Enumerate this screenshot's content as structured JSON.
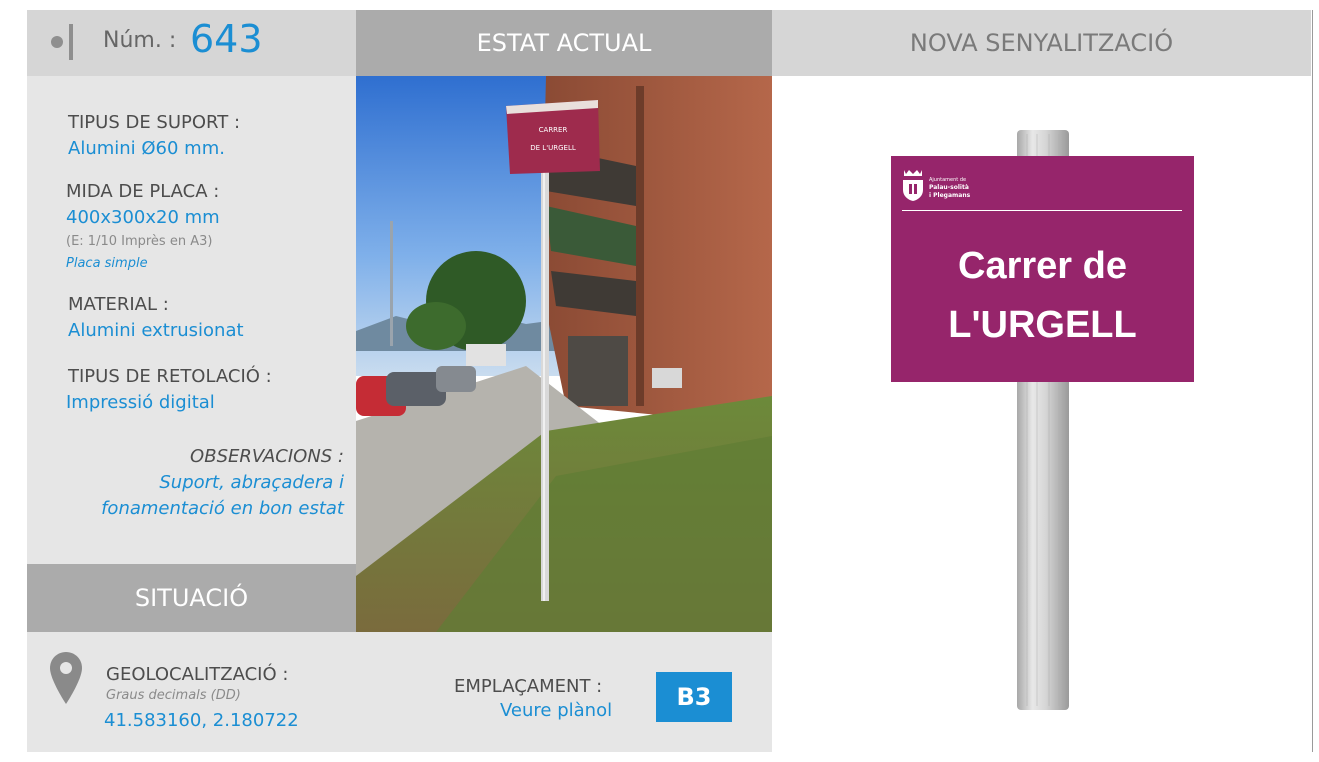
{
  "header": {
    "num_label": "Núm. :",
    "num_value": "643",
    "estat_actual": "ESTAT ACTUAL",
    "nova_senyalitzacio": "NOVA SENYALITZACIÓ"
  },
  "info": {
    "tipus_suport_label": "TIPUS DE SUPORT :",
    "tipus_suport_value": "Alumini Ø60 mm.",
    "mida_placa_label": "MIDA DE PLACA :",
    "mida_placa_value": "400x300x20 mm",
    "mida_placa_scale": "(E: 1/10 Imprès en A3)",
    "mida_placa_type": "Placa simple",
    "material_label": "MATERIAL :",
    "material_value": "Alumini extrusionat",
    "retolacio_label": "TIPUS DE RETOLACIÓ :",
    "retolacio_value": "Impressió digital",
    "observacions_label": "OBSERVACIONS :",
    "observacions_line1": "Suport, abraçadera i",
    "observacions_line2": "fonamentació en bon estat"
  },
  "situacio": {
    "title": "SITUACIÓ",
    "geo_label": "GEOLOCALITZACIÓ :",
    "geo_format": "Graus decimals (DD)",
    "geo_value": "41.583160, 2.180722",
    "emplacament_label": "EMPLAÇAMENT :",
    "emplacament_value": "Veure plànol",
    "emplacament_code": "B3"
  },
  "photo_sign": {
    "line1": "CARRER",
    "line2": "DE L'URGELL"
  },
  "new_sign": {
    "logo_line1": "Ajuntament de",
    "logo_line2": "Palau-solità",
    "logo_line3": "i Plegamans",
    "title_line1": "Carrer de",
    "title_line2": "L'URGELL"
  },
  "colors": {
    "accent_blue": "#1b8ed3",
    "sign_magenta": "#96256b",
    "header_grey": "#ababab",
    "panel_grey": "#e6e6e6"
  }
}
